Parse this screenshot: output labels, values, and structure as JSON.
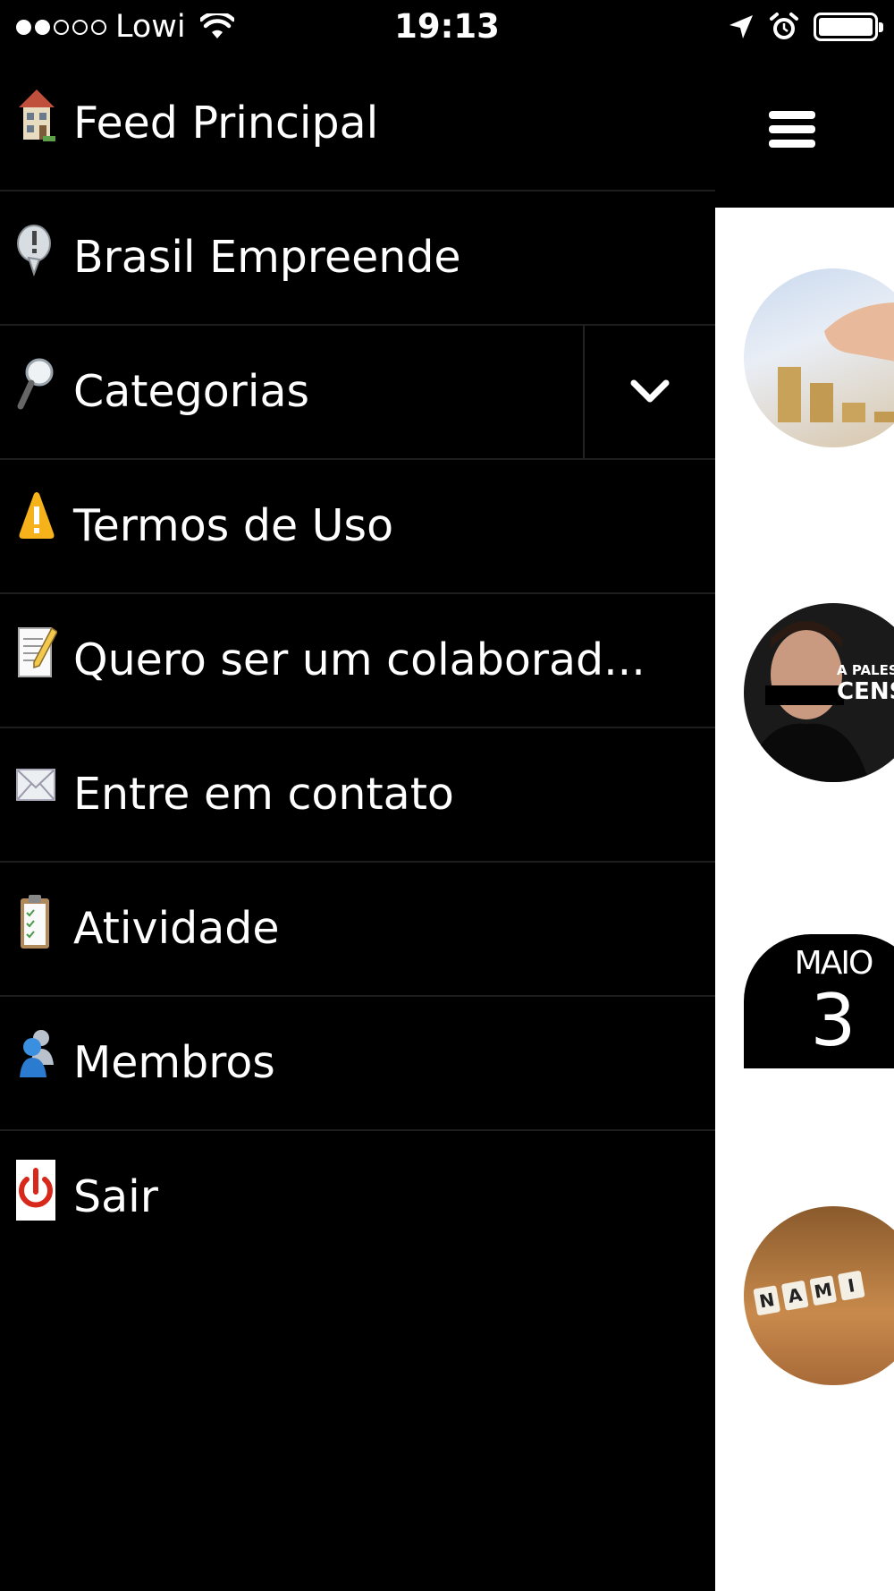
{
  "status_bar": {
    "carrier": "Lowi",
    "signal_dots": 5,
    "signal_filled": 2,
    "time": "19:13",
    "battery_level": 1.0
  },
  "menu": {
    "items": [
      {
        "label": "Feed Principal",
        "icon": "house-icon"
      },
      {
        "label": "Brasil Empreende",
        "icon": "info-bubble-icon"
      },
      {
        "label": "Categorias",
        "icon": "magnifier-icon",
        "expandable": true
      },
      {
        "label": "Termos de Uso",
        "icon": "warning-icon"
      },
      {
        "label": "Quero ser um colaborad...",
        "icon": "memo-icon"
      },
      {
        "label": "Entre em contato",
        "icon": "envelope-icon"
      },
      {
        "label": "Atividade",
        "icon": "clipboard-icon"
      },
      {
        "label": "Membros",
        "icon": "members-icon"
      },
      {
        "label": "Sair",
        "icon": "power-icon"
      }
    ]
  },
  "content": {
    "header_icon": "hamburger-menu-icon",
    "thumbnails": [
      {
        "name": "coins-thumbnail"
      },
      {
        "name": "palestra-thumbnail",
        "text_line1": "A PALEST",
        "text_line2": "CENS"
      },
      {
        "name": "date-thumbnail",
        "month": "MAIO",
        "day": "3"
      },
      {
        "name": "tiles-thumbnail",
        "letters": [
          "N",
          "A",
          "M",
          "I"
        ]
      }
    ]
  },
  "colors": {
    "menu_background": "#000000",
    "divider": "#1e1e1e",
    "content_background": "#ffffff"
  }
}
